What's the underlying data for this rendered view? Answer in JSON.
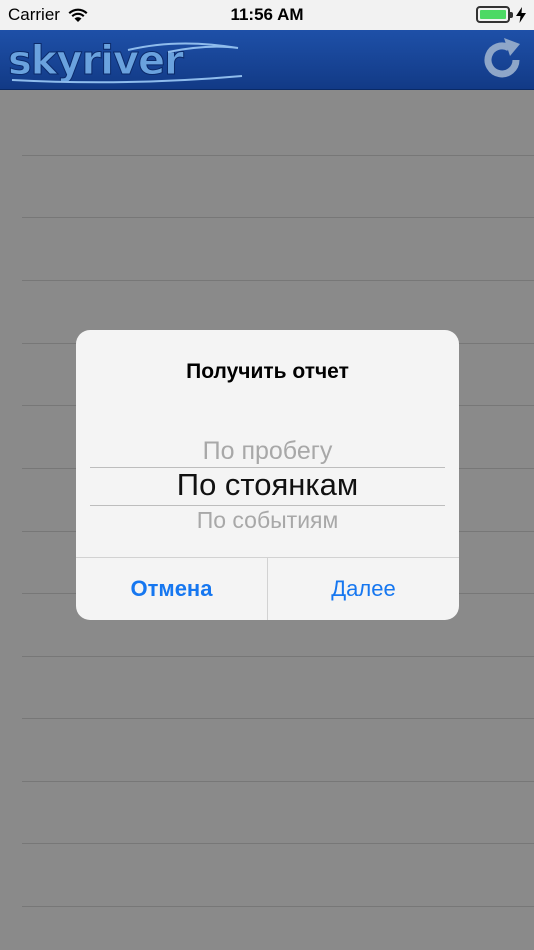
{
  "status_bar": {
    "carrier": "Carrier",
    "time": "11:56 AM"
  },
  "header": {
    "logo_text": "skyriver"
  },
  "alert": {
    "title": "Получить отчет",
    "picker": {
      "above": "По пробегу",
      "selected": "По стоянкам",
      "below": "По событиям"
    },
    "cancel_label": "Отмена",
    "next_label": "Далее"
  },
  "colors": {
    "accent": "#1677f0",
    "header_bg": "#1e50a8",
    "battery": "#4cd964"
  }
}
